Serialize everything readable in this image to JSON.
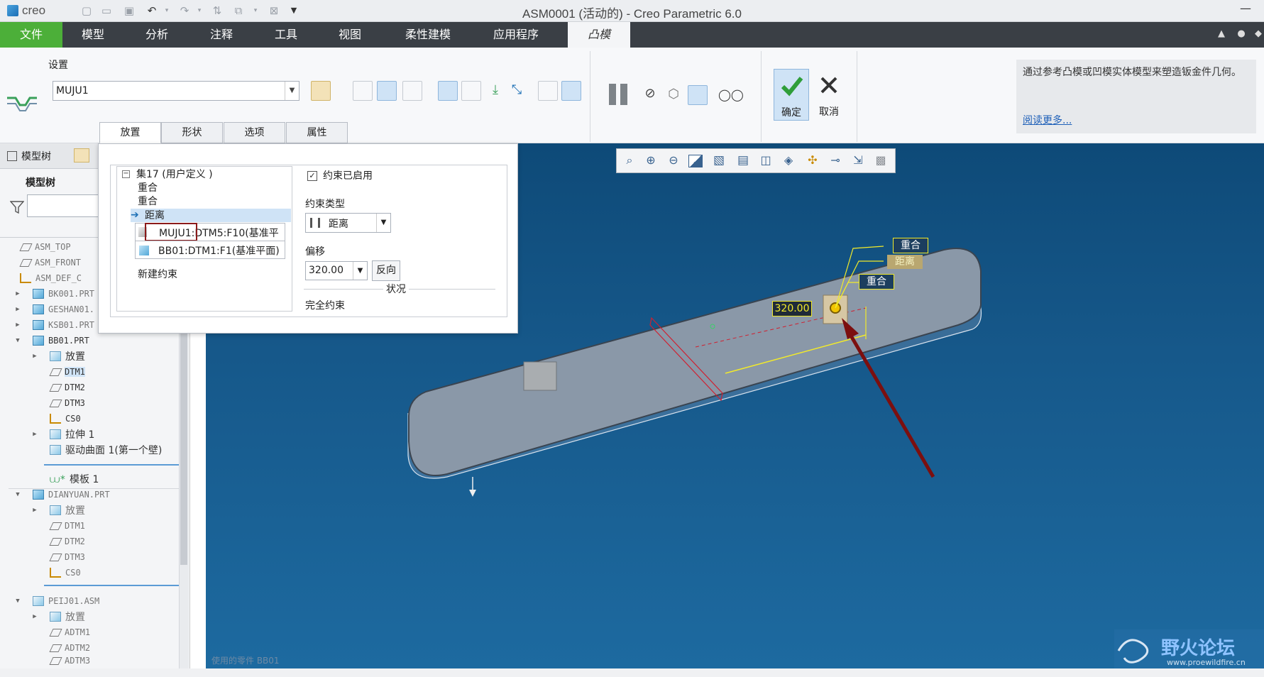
{
  "titlebar": {
    "app_logo": "creo",
    "title": "ASM0001 (活动的) - Creo Parametric 6.0"
  },
  "menubar": {
    "items": [
      "文件",
      "模型",
      "分析",
      "注释",
      "工具",
      "视图",
      "柔性建模",
      "应用程序",
      "凸模"
    ]
  },
  "ribbon": {
    "settings_label": "设置",
    "template_value": "MUJU1",
    "confirm_label": "确定",
    "cancel_label": "取消",
    "help_text": "通过参考凸模或凹模实体模型来塑造钣金件几何。",
    "help_link": "阅读更多..."
  },
  "panel_tabs": [
    "放置",
    "形状",
    "选项",
    "属性"
  ],
  "left_panel": {
    "tab_label": "模型树",
    "title": "模型树",
    "tree": [
      "ASM_TOP",
      "ASM_FRONT",
      "ASM_DEF_C",
      "BK001.PRT",
      "GESHAN01.",
      "KSB01.PRT",
      "BB01.PRT",
      "放置",
      "DTM1",
      "DTM2",
      "DTM3",
      "CS0",
      "拉伸 1",
      "驱动曲面 1(第一个壁)",
      "模板 1",
      "DIANYUAN.PRT",
      "放置",
      "DTM1",
      "DTM2",
      "DTM3",
      "CS0",
      "PEIJ01.ASM",
      "放置",
      "ADTM1",
      "ADTM2",
      "ADTM3"
    ]
  },
  "dialog": {
    "set_title": "集17 (用户定义 )",
    "constraints": [
      "重合",
      "重合",
      "距离"
    ],
    "ref1_highlight": "MUJU1",
    "ref1_rest": ":DTM5:F10(基准平",
    "ref2": "BB01:DTM1:F1(基准平面)",
    "new_constraint": "新建约束",
    "enabled_label": "约束已启用",
    "enabled_checked": "✓",
    "type_label": "约束类型",
    "type_value": "距离",
    "offset_label": "偏移",
    "offset_value": "320.00",
    "flip_label": "反向",
    "status_label": "状况",
    "status_value": "完全约束"
  },
  "viewport": {
    "dim_value": "320.00",
    "label_coincident_1": "重合",
    "label_distance": "距离",
    "label_coincident_2": "重合",
    "status_hint": "使用的零件 BB01"
  },
  "watermark": {
    "text": "野火论坛",
    "url": "www.proewildfire.cn"
  }
}
